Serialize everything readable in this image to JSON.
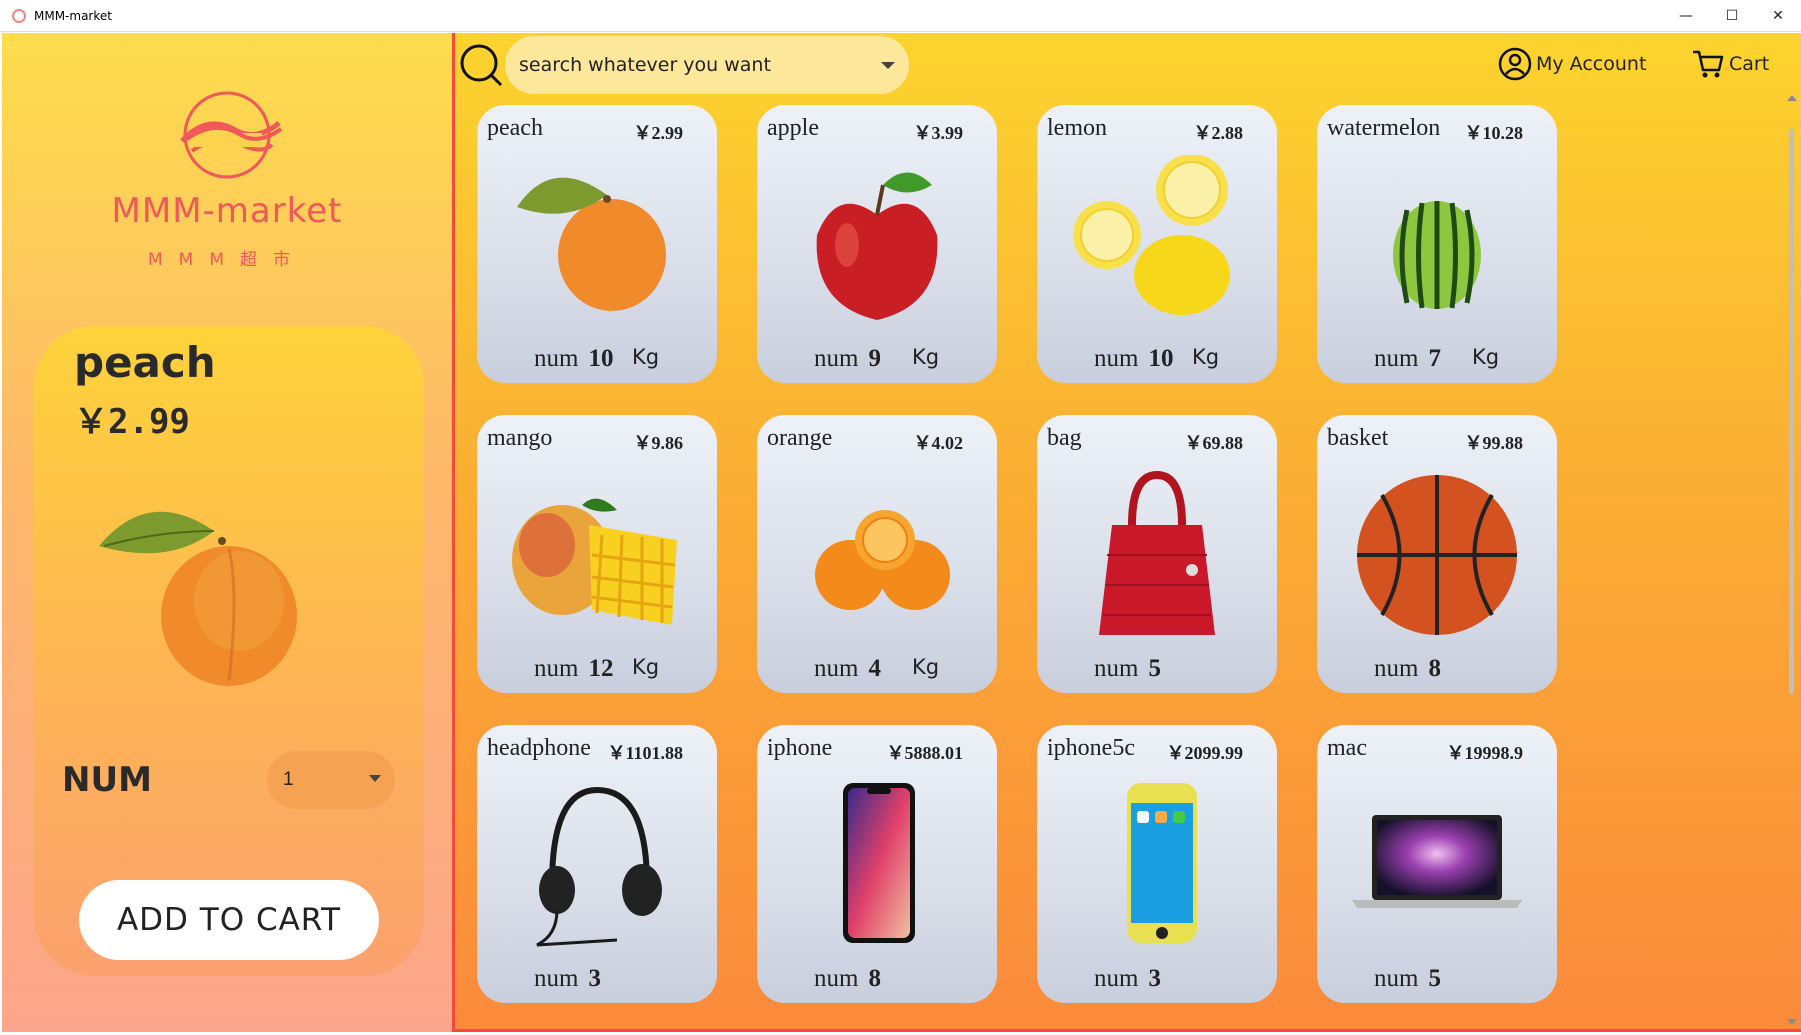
{
  "window": {
    "title": "MMM-market",
    "minimize": "—",
    "maximize": "☐",
    "close": "✕"
  },
  "logo": {
    "text": "MMM-market",
    "subtitle": "MMM超市"
  },
  "detail": {
    "name": "peach",
    "price": "￥2.99",
    "num_label": "NUM",
    "num_value": "1",
    "add_button": "ADD TO CART"
  },
  "header": {
    "search_placeholder": "search whatever you want",
    "account": "My Account",
    "cart": "Cart"
  },
  "num_label": "num",
  "products": [
    {
      "name": "peach",
      "price": "￥2.99",
      "num": "10",
      "unit": "Kg",
      "icon": "peach"
    },
    {
      "name": "apple",
      "price": "￥3.99",
      "num": "9",
      "unit": "Kg",
      "icon": "apple"
    },
    {
      "name": "lemon",
      "price": "￥2.88",
      "num": "10",
      "unit": "Kg",
      "icon": "lemon"
    },
    {
      "name": "watermelon",
      "price": "￥10.28",
      "num": "7",
      "unit": "Kg",
      "icon": "watermelon"
    },
    {
      "name": "mango",
      "price": "￥9.86",
      "num": "12",
      "unit": "Kg",
      "icon": "mango"
    },
    {
      "name": "orange",
      "price": "￥4.02",
      "num": "4",
      "unit": "Kg",
      "icon": "orange"
    },
    {
      "name": "bag",
      "price": "￥69.88",
      "num": "5",
      "unit": "",
      "icon": "bag"
    },
    {
      "name": "basket",
      "price": "￥99.88",
      "num": "8",
      "unit": "",
      "icon": "basketball"
    },
    {
      "name": "headphone",
      "price": "￥1101.88",
      "num": "3",
      "unit": "",
      "icon": "headphone"
    },
    {
      "name": "iphone",
      "price": "￥5888.01",
      "num": "8",
      "unit": "",
      "icon": "iphone"
    },
    {
      "name": "iphone5c",
      "price": "￥2099.99",
      "num": "3",
      "unit": "",
      "icon": "iphone5c"
    },
    {
      "name": "mac",
      "price": "￥19998.9",
      "num": "5",
      "unit": "",
      "icon": "laptop"
    }
  ]
}
